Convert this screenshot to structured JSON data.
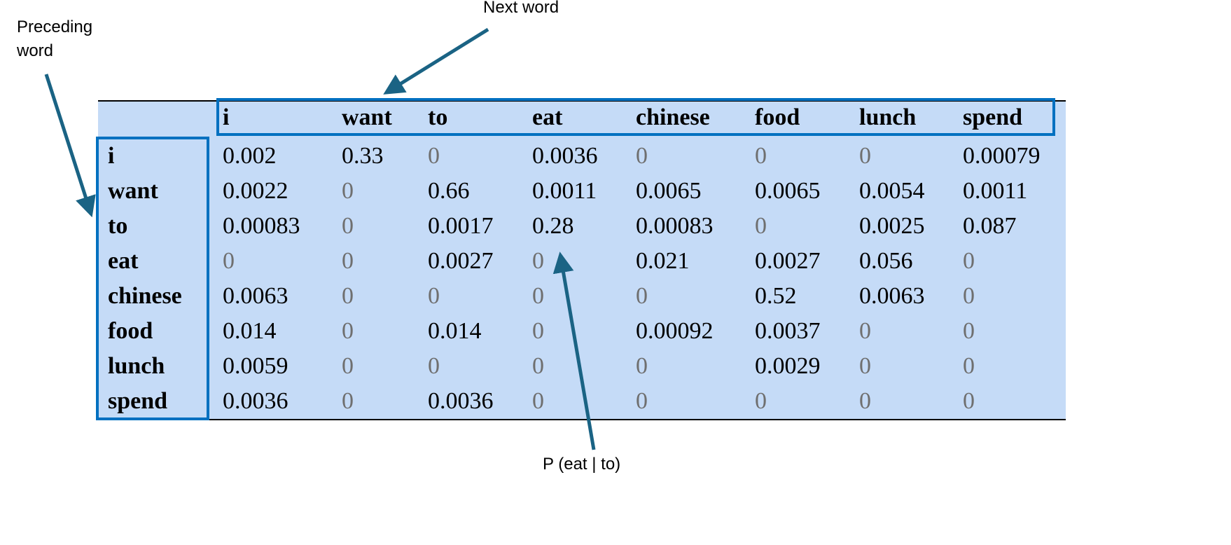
{
  "annotations": {
    "next_word": "Next word",
    "preceding_word": "Preceding word",
    "probability": "P (eat | to)"
  },
  "colors": {
    "table_bg": "#c5dbf7",
    "highlight_box": "#0070c0",
    "arrow": "#1a6384",
    "zero_text": "#6f6f6f"
  },
  "table": {
    "columns": [
      "i",
      "want",
      "to",
      "eat",
      "chinese",
      "food",
      "lunch",
      "spend"
    ],
    "rows": [
      {
        "label": "i",
        "values": [
          "0.002",
          "0.33",
          "0",
          "0.0036",
          "0",
          "0",
          "0",
          "0.00079"
        ]
      },
      {
        "label": "want",
        "values": [
          "0.0022",
          "0",
          "0.66",
          "0.0011",
          "0.0065",
          "0.0065",
          "0.0054",
          "0.0011"
        ]
      },
      {
        "label": "to",
        "values": [
          "0.00083",
          "0",
          "0.0017",
          "0.28",
          "0.00083",
          "0",
          "0.0025",
          "0.087"
        ]
      },
      {
        "label": "eat",
        "values": [
          "0",
          "0",
          "0.0027",
          "0",
          "0.021",
          "0.0027",
          "0.056",
          "0"
        ]
      },
      {
        "label": "chinese",
        "values": [
          "0.0063",
          "0",
          "0",
          "0",
          "0",
          "0.52",
          "0.0063",
          "0"
        ]
      },
      {
        "label": "food",
        "values": [
          "0.014",
          "0",
          "0.014",
          "0",
          "0.00092",
          "0.0037",
          "0",
          "0"
        ]
      },
      {
        "label": "lunch",
        "values": [
          "0.0059",
          "0",
          "0",
          "0",
          "0",
          "0.0029",
          "0",
          "0"
        ]
      },
      {
        "label": "spend",
        "values": [
          "0.0036",
          "0",
          "0.0036",
          "0",
          "0",
          "0",
          "0",
          "0"
        ]
      }
    ]
  }
}
